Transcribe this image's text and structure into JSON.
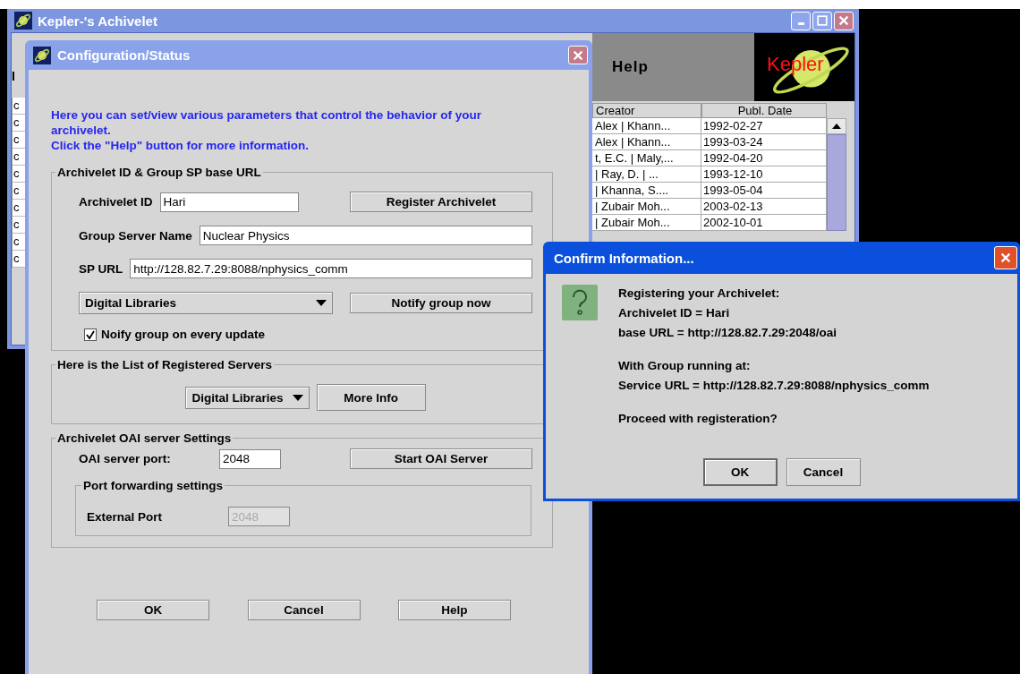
{
  "main_window": {
    "title": "Kepler-'s Achivelet",
    "left_label": "I",
    "left_cells": [
      "c",
      "c",
      "c",
      "c",
      "c",
      "c",
      "c",
      "c",
      "c",
      "c"
    ],
    "help_label": "Help",
    "logo_text": "Kepler",
    "table": {
      "columns": [
        "Creator",
        "Publ. Date"
      ],
      "rows": [
        {
          "creator": "Alex | Khann...",
          "date": "1992-02-27"
        },
        {
          "creator": "Alex | Khann...",
          "date": "1993-03-24"
        },
        {
          "creator": "t, E.C. | Maly,...",
          "date": "1992-04-20"
        },
        {
          "creator": "| Ray, D. | ...",
          "date": "1993-12-10"
        },
        {
          "creator": "| Khanna, S....",
          "date": "1993-05-04"
        },
        {
          "creator": "| Zubair Moh...",
          "date": "2003-02-13"
        },
        {
          "creator": "| Zubair Moh...",
          "date": "2002-10-01"
        }
      ]
    }
  },
  "config_dialog": {
    "title": "Configuration/Status",
    "intro": [
      "Here you can set/view various parameters that control the behavior of your archivelet.",
      "Click the \"Help\" button for more information."
    ],
    "id_section": {
      "legend": "Archivelet ID & Group SP base URL",
      "archivelet_id": {
        "label": "Archivelet ID",
        "value": "Hari"
      },
      "register_button": "Register Archivelet",
      "group_server_name": {
        "label": "Group Server Name",
        "value": "Nuclear Physics"
      },
      "sp_url": {
        "label": "SP URL",
        "value": "http://128.82.7.29:8088/nphysics_comm"
      },
      "group_dropdown": "Digital Libraries",
      "notify_button": "Notify group now",
      "notify_checkbox": {
        "label": "Noify group on every update",
        "checked": true
      }
    },
    "servers_section": {
      "legend": "Here is the List of Registered Servers",
      "dropdown": "Digital Libraries",
      "more_info_button": "More Info"
    },
    "oai_section": {
      "legend": "Archivelet OAI server Settings",
      "port": {
        "label": "OAI server port:",
        "value": "2048"
      },
      "start_button": "Start OAI Server",
      "forwarding": {
        "legend": "Port forwarding settings",
        "external_port": {
          "label": "External Port",
          "value": "2048",
          "disabled": true
        }
      }
    },
    "buttons": [
      "OK",
      "Cancel",
      "Help"
    ]
  },
  "confirm_dialog": {
    "title": "Confirm Information...",
    "paragraphs": [
      [
        "Registering your Archivelet:",
        "Archivelet ID = Hari",
        "base URL = http://128.82.7.29:2048/oai"
      ],
      [
        "With Group running at:",
        "Service URL = http://128.82.7.29:8088/nphysics_comm"
      ],
      [
        "Proceed with registeration?"
      ]
    ],
    "buttons": [
      {
        "label": "OK",
        "selected": true
      },
      {
        "label": "Cancel",
        "selected": false
      }
    ]
  }
}
